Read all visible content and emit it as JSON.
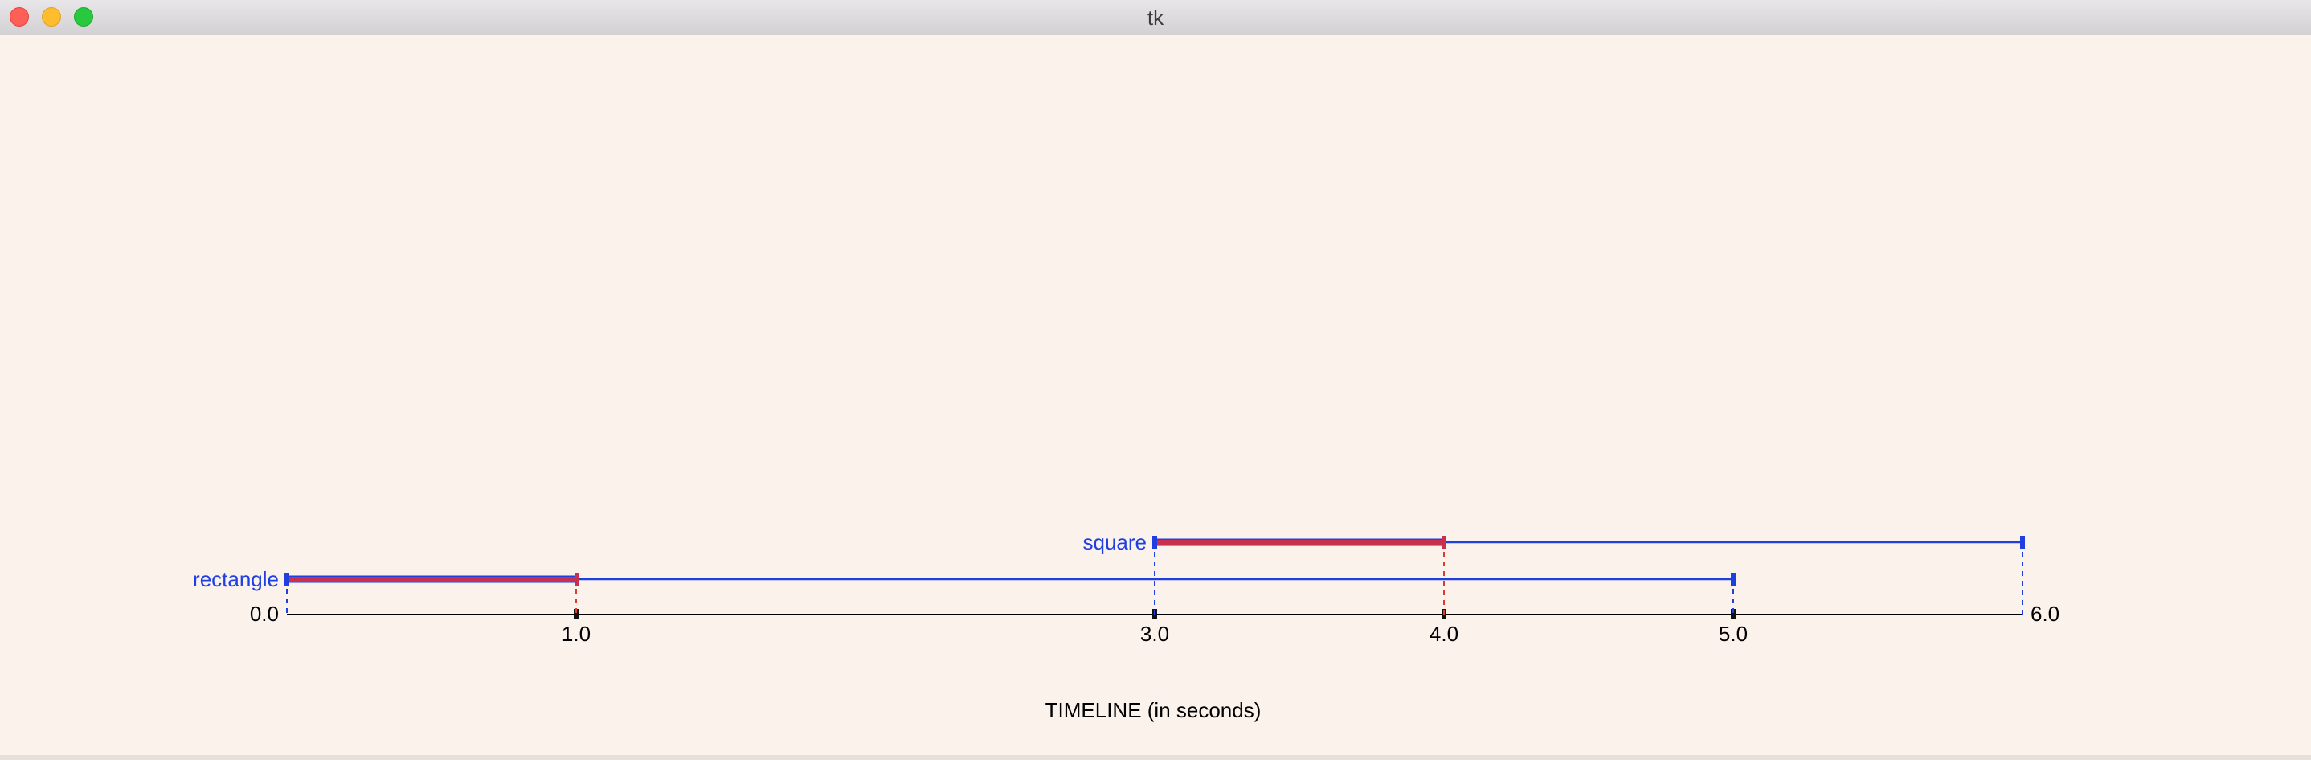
{
  "window": {
    "title": "tk"
  },
  "timeline": {
    "label": "TIMELINE (in seconds)",
    "axis_ticks": [
      {
        "value": 0.0,
        "label": "0.0",
        "anchor": "end"
      },
      {
        "value": 1.0,
        "label": "1.0",
        "anchor": "middle"
      },
      {
        "value": 3.0,
        "label": "3.0",
        "anchor": "middle"
      },
      {
        "value": 4.0,
        "label": "4.0",
        "anchor": "middle"
      },
      {
        "value": 5.0,
        "label": "5.0",
        "anchor": "middle"
      },
      {
        "value": 6.0,
        "label": "6.0",
        "anchor": "start"
      }
    ],
    "x_range": [
      0.0,
      6.0
    ],
    "colors": {
      "background": "#fbf2ec",
      "axis": "#000000",
      "track": "#1f3fe0",
      "progress": "#c8304f",
      "guide_blue": "#1f3fe0",
      "guide_red": "#e03a2f"
    },
    "tracks": [
      {
        "name": "rectangle",
        "start": 0.0,
        "end": 5.0,
        "progress_end": 1.0
      },
      {
        "name": "square",
        "start": 3.0,
        "end": 6.0,
        "progress_end": 4.0
      }
    ]
  }
}
